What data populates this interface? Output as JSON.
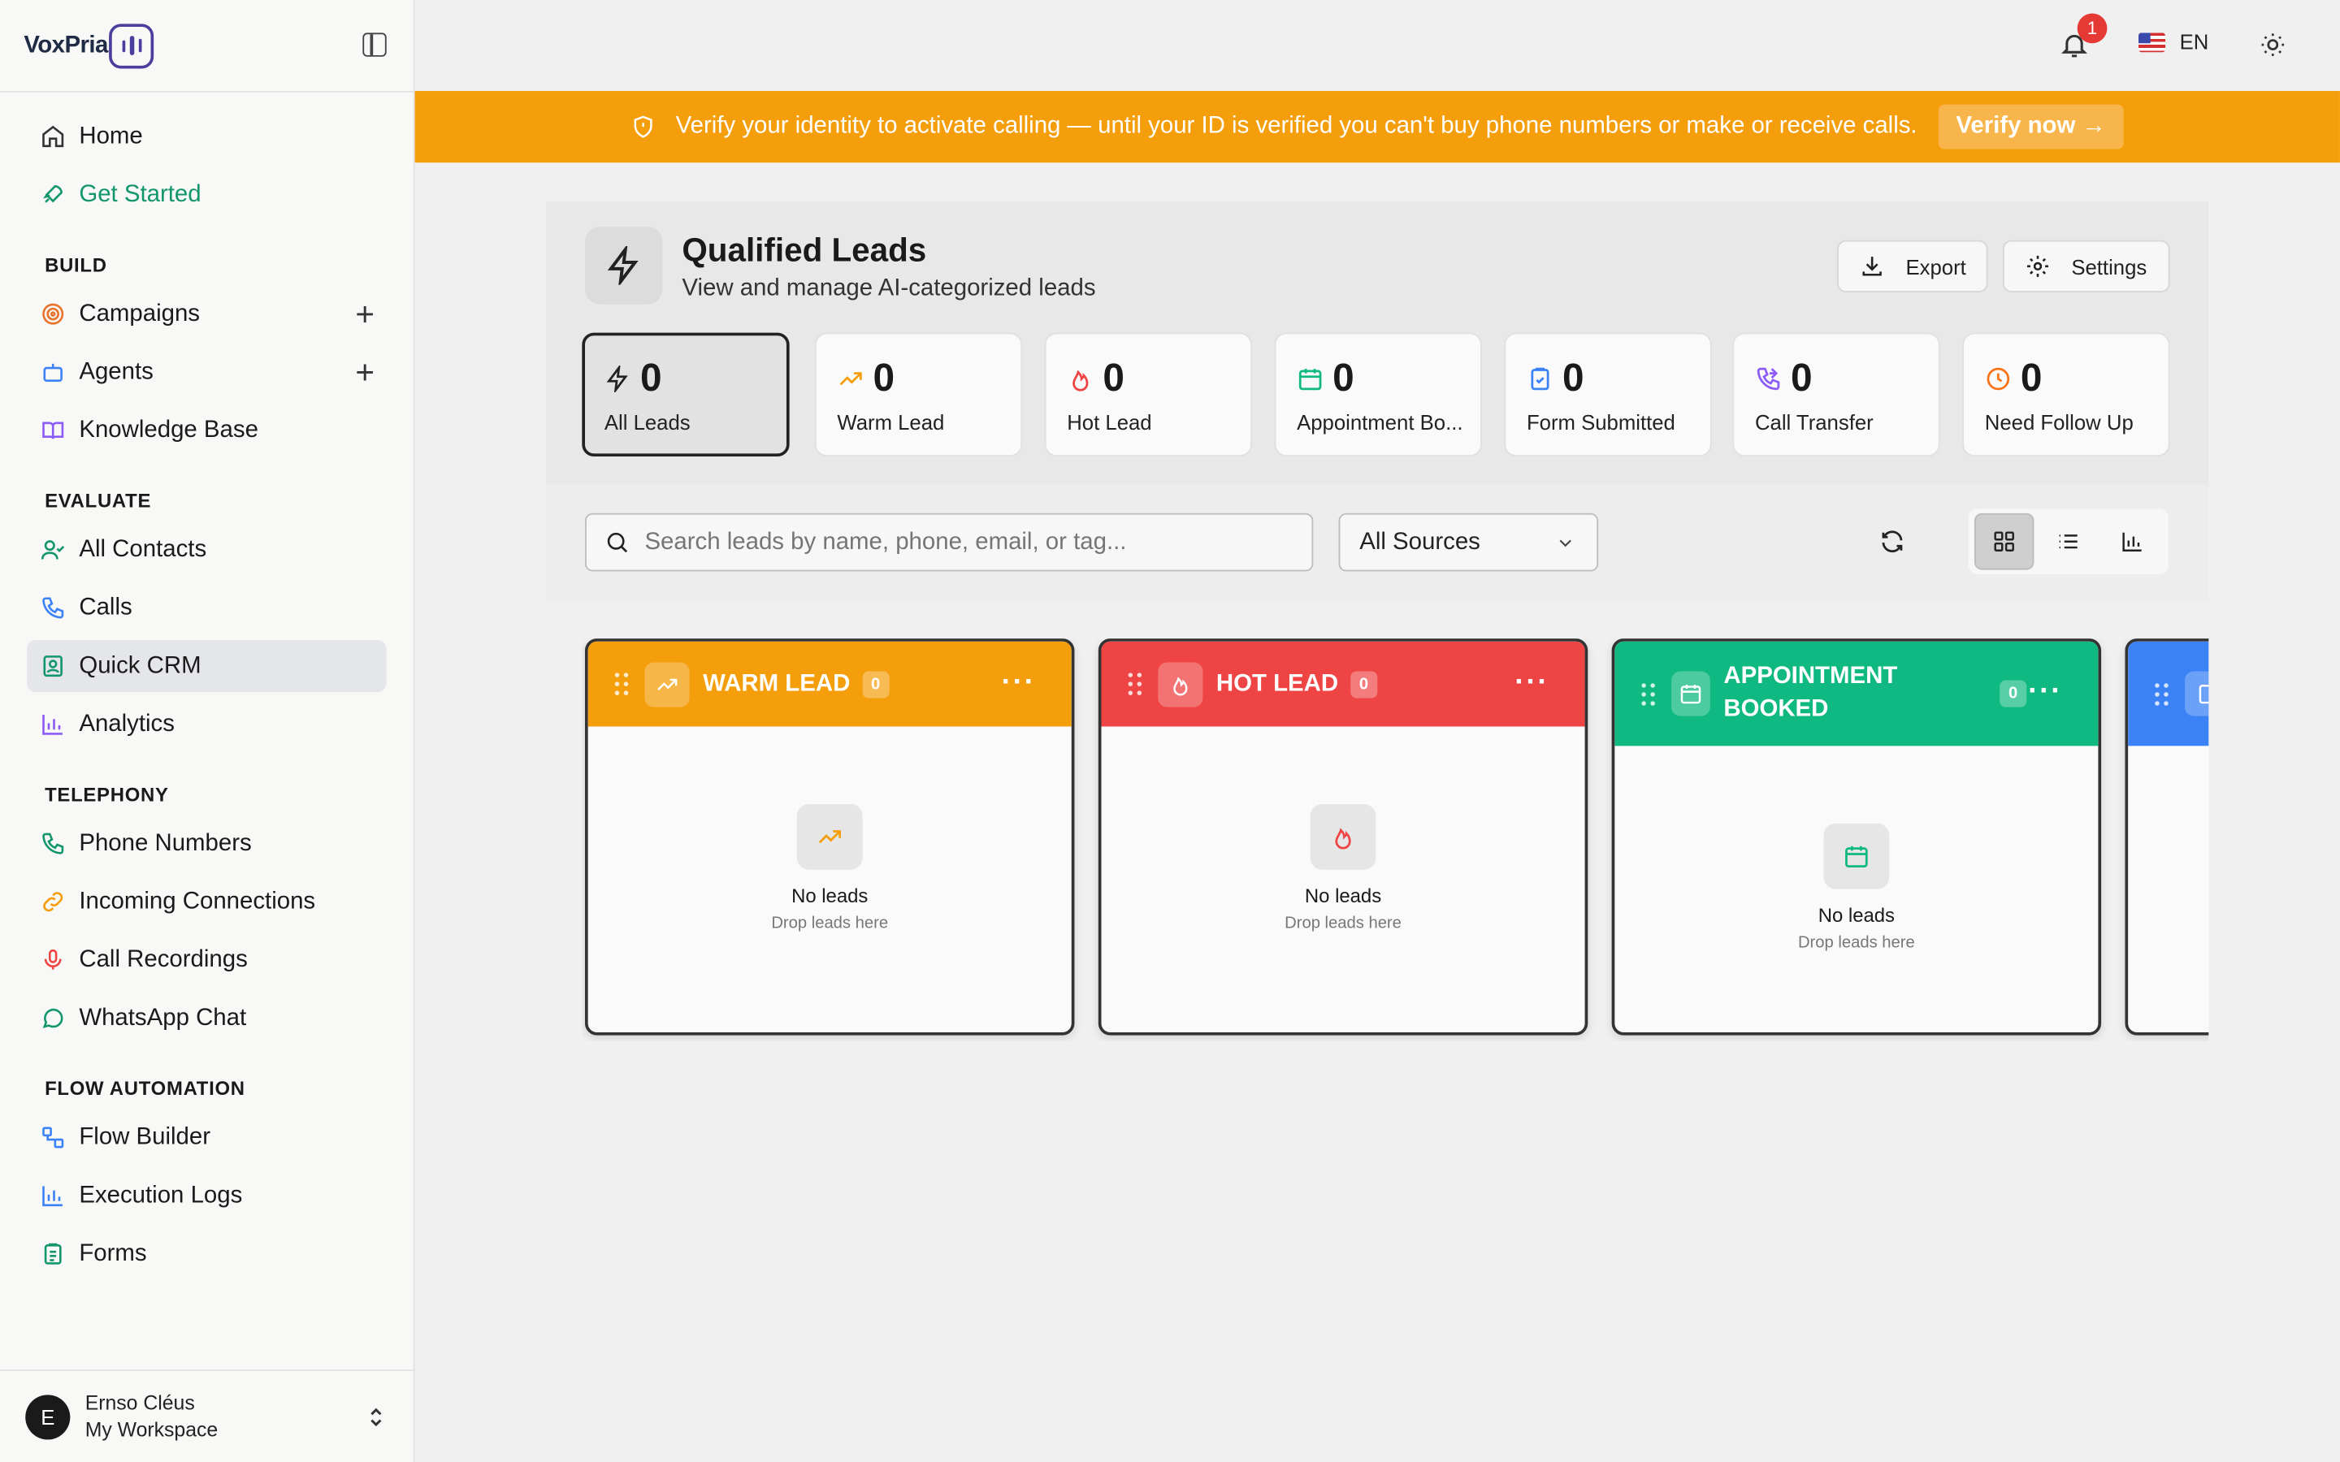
{
  "brand": {
    "name": "VoxPria"
  },
  "sidebar": {
    "top_items": [
      {
        "label": "Home",
        "icon": "home-icon"
      },
      {
        "label": "Get Started",
        "icon": "rocket-icon"
      }
    ],
    "sections": [
      {
        "title": "BUILD",
        "items": [
          {
            "label": "Campaigns",
            "icon": "target-icon"
          },
          {
            "label": "Agents",
            "icon": "bot-icon"
          },
          {
            "label": "Knowledge Base",
            "icon": "book-icon"
          }
        ]
      },
      {
        "title": "EVALUATE",
        "items": [
          {
            "label": "All Contacts",
            "icon": "user-check-icon"
          },
          {
            "label": "Calls",
            "icon": "phone-icon"
          },
          {
            "label": "Quick CRM",
            "icon": "contact-card-icon"
          },
          {
            "label": "Analytics",
            "icon": "bar-chart-icon"
          }
        ]
      },
      {
        "title": "TELEPHONY",
        "items": [
          {
            "label": "Phone Numbers",
            "icon": "phone-icon"
          },
          {
            "label": "Incoming Connections",
            "icon": "link-icon"
          },
          {
            "label": "Call Recordings",
            "icon": "mic-icon"
          },
          {
            "label": "WhatsApp Chat",
            "icon": "chat-icon"
          }
        ]
      },
      {
        "title": "FLOW AUTOMATION",
        "items": [
          {
            "label": "Flow Builder",
            "icon": "workflow-icon"
          },
          {
            "label": "Execution Logs",
            "icon": "bar-chart-icon"
          },
          {
            "label": "Forms",
            "icon": "clipboard-icon"
          }
        ]
      }
    ],
    "user": {
      "initial": "E",
      "name": "Ernso Cléus",
      "workspace": "My Workspace"
    }
  },
  "topbar": {
    "notification_count": "1",
    "language": "EN"
  },
  "banner": {
    "text": "Verify your identity to activate calling — until your ID is verified you can't buy phone numbers or make or receive calls.",
    "button": "Verify now →"
  },
  "header": {
    "title": "Qualified Leads",
    "subtitle": "View and manage AI-categorized leads",
    "export_label": "Export",
    "settings_label": "Settings"
  },
  "stats": [
    {
      "value": "0",
      "label": "All Leads",
      "icon": "bolt-icon",
      "color": "#222222"
    },
    {
      "value": "0",
      "label": "Warm Lead",
      "icon": "trending-up-icon",
      "color": "#f59e0b"
    },
    {
      "value": "0",
      "label": "Hot Lead",
      "icon": "flame-icon",
      "color": "#ef4444"
    },
    {
      "value": "0",
      "label": "Appointment Bo...",
      "icon": "calendar-icon",
      "color": "#10b981"
    },
    {
      "value": "0",
      "label": "Form Submitted",
      "icon": "clipboard-check-icon",
      "color": "#3b82f6"
    },
    {
      "value": "0",
      "label": "Call Transfer",
      "icon": "phone-forward-icon",
      "color": "#8b5cf6"
    },
    {
      "value": "0",
      "label": "Need Follow Up",
      "icon": "clock-icon",
      "color": "#f97316"
    }
  ],
  "filters": {
    "search_placeholder": "Search leads by name, phone, email, or tag...",
    "source_selected": "All Sources"
  },
  "columns": [
    {
      "title": "WARM LEAD",
      "count": "0",
      "color": "#f59e0b",
      "icon": "trending-up-icon",
      "empty_title": "No leads",
      "empty_sub": "Drop leads here"
    },
    {
      "title": "HOT LEAD",
      "count": "0",
      "color": "#ef4444",
      "icon": "flame-icon",
      "empty_title": "No leads",
      "empty_sub": "Drop leads here"
    },
    {
      "title": "APPOINTMENT BOOKED",
      "title_line1": "APPOINTMENT",
      "title_line2": "BOOKED",
      "count": "0",
      "color": "#10b981",
      "icon": "calendar-icon",
      "empty_title": "No leads",
      "empty_sub": "Drop leads here"
    },
    {
      "title": "",
      "count": "",
      "color": "#3b82f6",
      "icon": "clipboard-icon"
    }
  ]
}
